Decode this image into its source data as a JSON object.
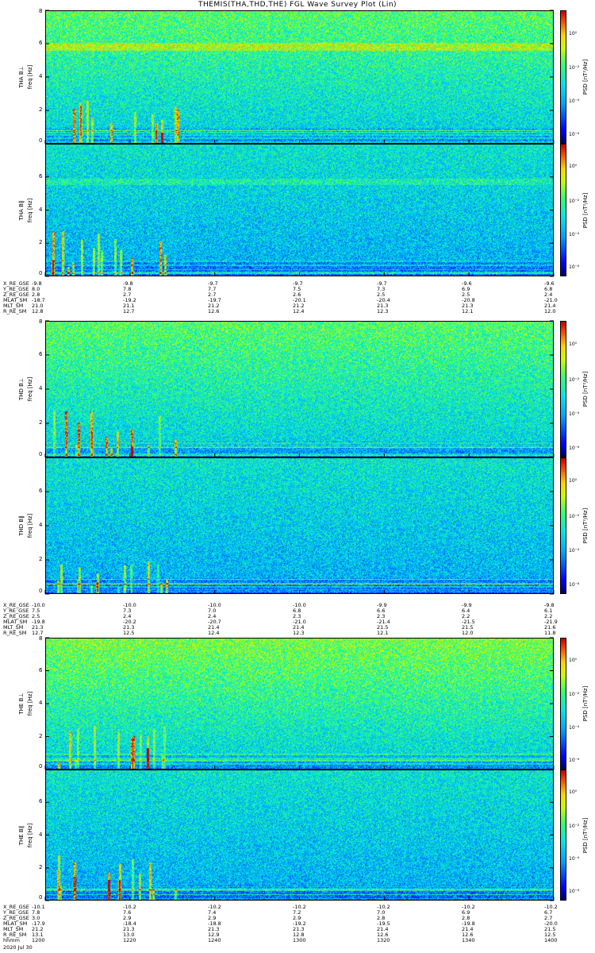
{
  "title": "THEMIS(THA,THD,THE) FGL Wave Survey Plot (Lin)",
  "colors": {
    "background": "#ffffff",
    "axis": "#000000"
  },
  "colorbar": {
    "label": "PSD [nT²/Hz]",
    "ticks": [
      "10⁰",
      "10⁻²",
      "10⁻⁴",
      "10⁻⁶"
    ]
  },
  "chart_data": [
    {
      "type": "heatmap",
      "panel": "THA BL",
      "ylabel_top": "THA B⊥",
      "ylabel_bottom": "freq [Hz]",
      "ylim": [
        0,
        8
      ],
      "yticks": [
        "0",
        "2",
        "4",
        "6",
        "8"
      ],
      "zlabel": "PSD [nT²/Hz]",
      "zlog": true,
      "features": {
        "band_hz": 5.8,
        "low_freq_enhancement": true
      }
    },
    {
      "type": "heatmap",
      "panel": "THA BII",
      "ylabel_top": "THA B∥",
      "ylabel_bottom": "freq [Hz]",
      "ylim": [
        0,
        8
      ],
      "yticks": [
        "0",
        "2",
        "4",
        "6"
      ],
      "zlabel": "PSD [nT²/Hz]",
      "zlog": true,
      "features": {
        "band_hz": 5.8,
        "low_freq_enhancement": true
      }
    },
    {
      "type": "heatmap",
      "panel": "THD BL",
      "ylabel_top": "THD B⊥",
      "ylabel_bottom": "freq [Hz]",
      "ylim": [
        0,
        8
      ],
      "yticks": [
        "0",
        "2",
        "4",
        "6",
        "8"
      ],
      "zlabel": "PSD [nT²/Hz]",
      "zlog": true
    },
    {
      "type": "heatmap",
      "panel": "THD BII",
      "ylabel_top": "THD B∥",
      "ylabel_bottom": "freq [Hz]",
      "ylim": [
        0,
        8
      ],
      "yticks": [
        "0",
        "2",
        "4",
        "6"
      ],
      "zlabel": "PSD [nT²/Hz]",
      "zlog": true
    },
    {
      "type": "heatmap",
      "panel": "THE BL",
      "ylabel_top": "THE B⊥",
      "ylabel_bottom": "freq [Hz]",
      "ylim": [
        0,
        8
      ],
      "yticks": [
        "0",
        "2",
        "4",
        "6",
        "8"
      ],
      "zlabel": "PSD [nT²/Hz]",
      "zlog": true
    },
    {
      "type": "heatmap",
      "panel": "THE BII",
      "ylabel_top": "THE B∥",
      "ylabel_bottom": "freq [Hz]",
      "ylim": [
        0,
        8
      ],
      "yticks": [
        "0",
        "2",
        "4",
        "6"
      ],
      "zlabel": "PSD [nT²/Hz]",
      "zlog": true
    }
  ],
  "ephemeris": [
    {
      "rows": [
        {
          "label": "X_RE_GSE",
          "values": [
            "-9.8",
            "-9.8",
            "-9.7",
            "-9.7",
            "-9.7",
            "-9.6",
            "-9.6"
          ]
        },
        {
          "label": "Y_RE_GSE",
          "values": [
            "8.0",
            "7.8",
            "7.7",
            "7.5",
            "7.3",
            "6.9",
            "6.8"
          ]
        },
        {
          "label": "Z_RE_GSE",
          "values": [
            "2.8",
            "2.7",
            "2.7",
            "2.6",
            "2.5",
            "2.5",
            "2.4"
          ]
        },
        {
          "label": "MLAT_SM",
          "values": [
            "-18.7",
            "-19.2",
            "-19.7",
            "-20.1",
            "-20.4",
            "-20.8",
            "-21.0"
          ]
        },
        {
          "label": "MLT_SM",
          "values": [
            "21.0",
            "21.1",
            "21.2",
            "21.2",
            "21.3",
            "21.3",
            "21.4"
          ]
        },
        {
          "label": "R_RE_SM",
          "values": [
            "12.8",
            "12.7",
            "12.6",
            "12.4",
            "12.3",
            "12.1",
            "12.0"
          ]
        }
      ]
    },
    {
      "rows": [
        {
          "label": "X_RE_GSE",
          "values": [
            "-10.0",
            "-10.0",
            "-10.0",
            "-10.0",
            "-9.9",
            "-9.9",
            "-9.8"
          ]
        },
        {
          "label": "Y_RE_GSE",
          "values": [
            "7.5",
            "7.3",
            "7.0",
            "6.8",
            "6.6",
            "6.4",
            "6.1"
          ]
        },
        {
          "label": "Z_RE_GSE",
          "values": [
            "2.5",
            "2.4",
            "2.4",
            "2.3",
            "2.3",
            "2.2",
            "2.2"
          ]
        },
        {
          "label": "MLAT_SM",
          "values": [
            "-19.8",
            "-20.2",
            "-20.7",
            "-21.0",
            "-21.4",
            "-21.5",
            "-21.9"
          ]
        },
        {
          "label": "MLT_SM",
          "values": [
            "21.3",
            "21.3",
            "21.4",
            "21.4",
            "21.5",
            "21.5",
            "21.6"
          ]
        },
        {
          "label": "R_RE_SM",
          "values": [
            "12.7",
            "12.5",
            "12.4",
            "12.3",
            "12.1",
            "12.0",
            "11.8"
          ]
        }
      ]
    },
    {
      "rows": [
        {
          "label": "X_RE_GSE",
          "values": [
            "-10.1",
            "-10.2",
            "-10.2",
            "-10.2",
            "-10.2",
            "-10.2",
            "-10.2"
          ]
        },
        {
          "label": "Y_RE_GSE",
          "values": [
            "7.8",
            "7.6",
            "7.4",
            "7.2",
            "7.0",
            "6.9",
            "6.7"
          ]
        },
        {
          "label": "Z_RE_GSE",
          "values": [
            "3.0",
            "2.9",
            "2.9",
            "2.9",
            "2.8",
            "2.8",
            "2.7"
          ]
        },
        {
          "label": "MLAT_SM",
          "values": [
            "-17.9",
            "-18.4",
            "-18.8",
            "-19.2",
            "-19.5",
            "-19.8",
            "-20.0"
          ]
        },
        {
          "label": "MLT_SM",
          "values": [
            "21.2",
            "21.3",
            "21.3",
            "21.3",
            "21.4",
            "21.4",
            "21.5"
          ]
        },
        {
          "label": "R_RE_SM",
          "values": [
            "13.1",
            "13.0",
            "12.9",
            "12.8",
            "12.6",
            "12.6",
            "12.5"
          ]
        },
        {
          "label": "hhmm",
          "values": [
            "1200",
            "1220",
            "1240",
            "1300",
            "1320",
            "1340",
            "1400"
          ]
        }
      ]
    }
  ],
  "date_label": "2020 Jul 30"
}
